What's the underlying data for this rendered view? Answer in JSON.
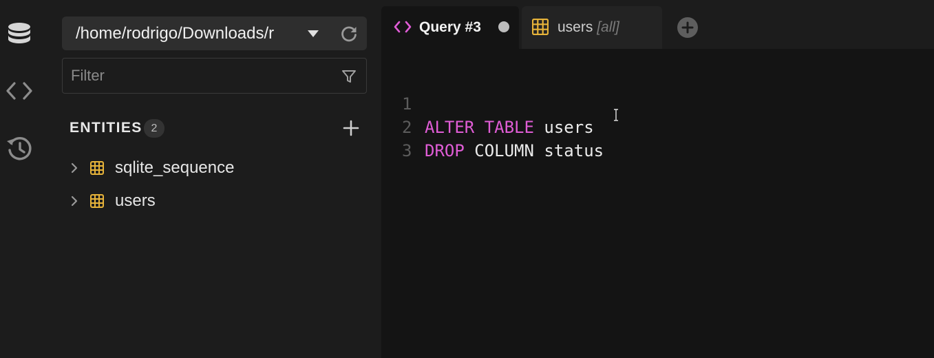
{
  "app": {
    "colors": {
      "background": "#1c1c1c",
      "editor_background": "#141414",
      "keyword": "#e05dd6",
      "table_icon": "#e8b43a"
    }
  },
  "activity_bar": {
    "items": [
      {
        "icon": "database-icon"
      },
      {
        "icon": "code-icon"
      },
      {
        "icon": "history-icon"
      }
    ]
  },
  "sidebar": {
    "db_path": "/home/rodrigo/Downloads/r",
    "filter": {
      "placeholder": "Filter",
      "value": ""
    },
    "entities_label": "ENTITIES",
    "entities_count": "2",
    "entities": [
      {
        "name": "sqlite_sequence",
        "icon": "table-icon"
      },
      {
        "name": "users",
        "icon": "table-icon"
      }
    ]
  },
  "tabs": [
    {
      "label": "Query #3",
      "icon": "code-icon",
      "active": true,
      "unsaved": true
    },
    {
      "label": "users",
      "sublabel": "[all]",
      "icon": "table-icon",
      "active": false
    }
  ],
  "editor": {
    "lines": [
      {
        "number": "1",
        "tokens": [
          {
            "text": "ALTER TABLE",
            "type": "keyword"
          },
          {
            "text": " users",
            "type": "identifier"
          }
        ]
      },
      {
        "number": "2",
        "tokens": [
          {
            "text": "DROP",
            "type": "keyword"
          },
          {
            "text": " COLUMN status",
            "type": "identifier"
          }
        ]
      },
      {
        "number": "3",
        "tokens": []
      }
    ]
  }
}
